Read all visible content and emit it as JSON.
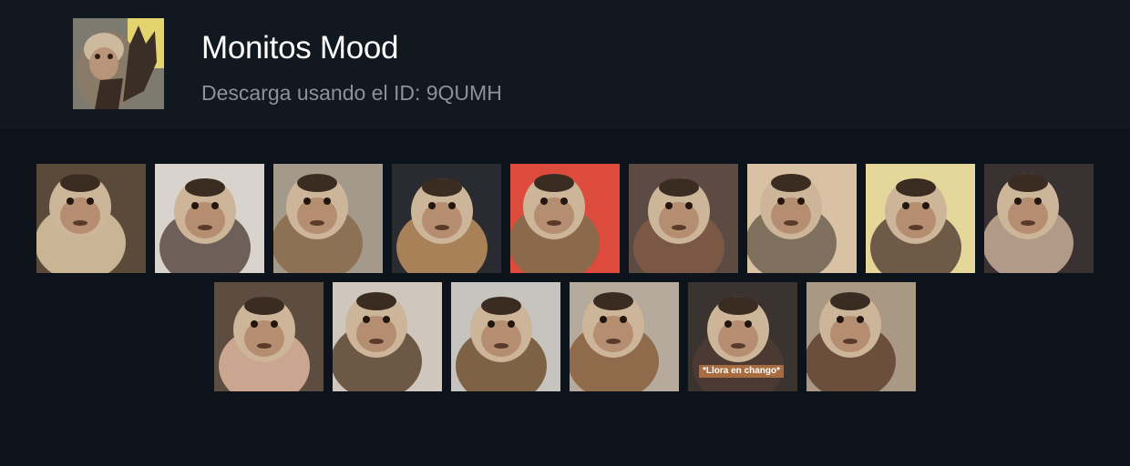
{
  "header": {
    "title": "Monitos Mood",
    "subtitle": "Descarga usando el ID: 9QUMH",
    "pack_icon": "monkey-waving-icon"
  },
  "stickers": {
    "row1": [
      {
        "icon": "monkey-sleepy-sticker",
        "bg": "#5a4a3a",
        "accent": "#c9b493"
      },
      {
        "icon": "monkey-tilted-sticker",
        "bg": "#d8d3cc",
        "accent": "#6e6058"
      },
      {
        "icon": "monkey-tongue-sticker",
        "bg": "#a49a8c",
        "accent": "#8d7155"
      },
      {
        "icon": "monkey-chair-sticker",
        "bg": "#2a2b30",
        "accent": "#a98158"
      },
      {
        "icon": "monkey-red-blanket-sticker",
        "bg": "#dd4b3d",
        "accent": "#8a6a4a"
      },
      {
        "icon": "monkey-juice-sticker",
        "bg": "#5c4a43",
        "accent": "#7a5845"
      },
      {
        "icon": "monkey-grin-sticker",
        "bg": "#d9c2a4",
        "accent": "#7f705d"
      },
      {
        "icon": "monkey-waving-sticker",
        "bg": "#e5d79a",
        "accent": "#6f5a48"
      },
      {
        "icon": "monkey-teeth-sticker",
        "bg": "#3a3232",
        "accent": "#b19a88"
      }
    ],
    "row2": [
      {
        "icon": "monkey-smile-sticker",
        "bg": "#5d4d40",
        "accent": "#caa690"
      },
      {
        "icon": "monkey-table-sticker",
        "bg": "#cfc7bd",
        "accent": "#6d5846"
      },
      {
        "icon": "monkey-pillow-sticker",
        "bg": "#c7c3be",
        "accent": "#7e6245"
      },
      {
        "icon": "monkey-sofa-sticker",
        "bg": "#b6aa9c",
        "accent": "#8f6b4c"
      },
      {
        "icon": "monkey-crying-sticker",
        "bg": "#3b3330",
        "accent": "#4b3a31",
        "caption": "*Llora en chango*"
      },
      {
        "icon": "monkey-eating-sticker",
        "bg": "#a99883",
        "accent": "#6b4e3c"
      }
    ]
  }
}
